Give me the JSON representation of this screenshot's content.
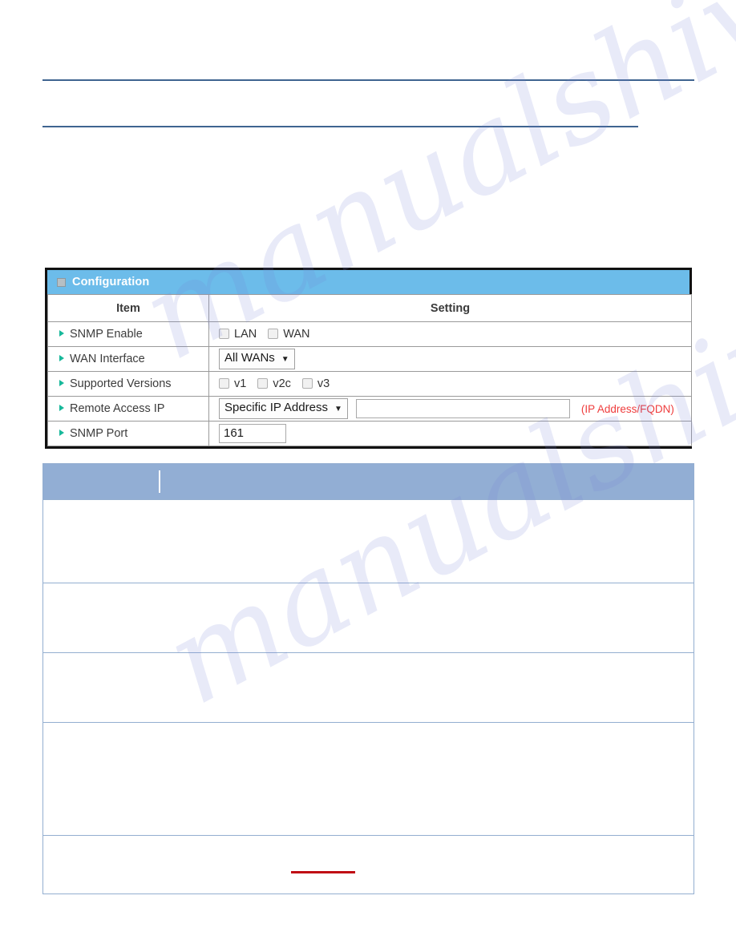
{
  "page": {
    "watermark_line_1": "manualshive.com",
    "watermark_line_2": "manualshive.com"
  },
  "config_panel": {
    "title": "Configuration",
    "panel_icon": "minimize-square-icon",
    "columns": {
      "item": "Item",
      "setting": "Setting"
    },
    "rows": [
      {
        "label": "SNMP Enable",
        "type": "checkboxes",
        "checkboxes": [
          {
            "label": "LAN",
            "checked": false
          },
          {
            "label": "WAN",
            "checked": false
          }
        ]
      },
      {
        "label": "WAN Interface",
        "type": "select",
        "selected": "All WANs",
        "caret": "▼"
      },
      {
        "label": "Supported Versions",
        "type": "checkboxes",
        "checkboxes": [
          {
            "label": "v1",
            "checked": false
          },
          {
            "label": "v2c",
            "checked": false
          },
          {
            "label": "v3",
            "checked": false
          }
        ]
      },
      {
        "label": "Remote Access IP",
        "type": "select-plus-text",
        "selected": "Specific IP Address",
        "caret": "▼",
        "text_value": "",
        "text_placeholder": "",
        "hint": "(IP Address/FQDN)",
        "hint_color": "#ef3c3c"
      },
      {
        "label": "SNMP Port",
        "type": "text",
        "text_value": "161",
        "text_placeholder": ""
      }
    ]
  },
  "description_panel": {
    "header": {
      "col_1": "",
      "col_2": ""
    },
    "rows": [
      {
        "col_1": "",
        "col_2": ""
      },
      {
        "col_1": "",
        "col_2": ""
      },
      {
        "col_1": "",
        "col_2": ""
      },
      {
        "col_1": "",
        "col_2": ""
      },
      {
        "col_1": "",
        "col_2": ""
      }
    ]
  },
  "colors": {
    "config_header_blue": "#6cbcea",
    "description_header_blue": "#92aed4",
    "rule_blue": "#3f6490",
    "bullet_green": "#17b89a",
    "hint_red": "#ef3c3c",
    "underline_red": "#c00b14"
  }
}
